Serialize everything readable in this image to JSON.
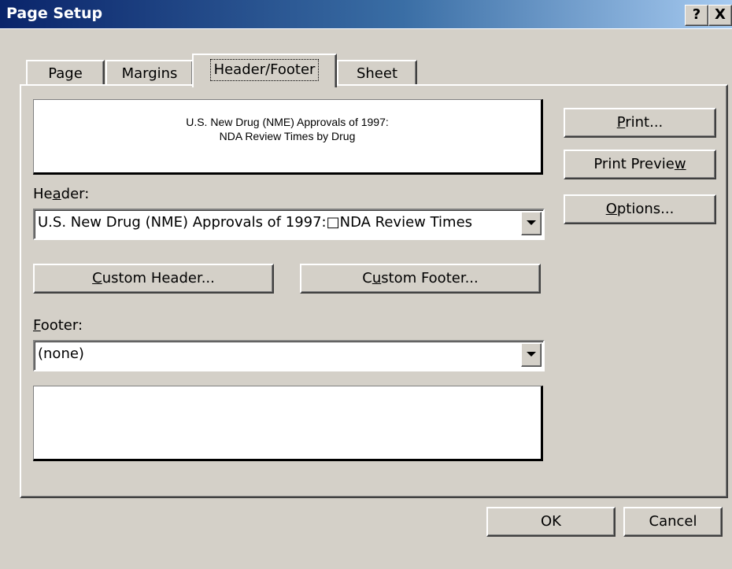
{
  "window": {
    "title": "Page Setup",
    "help_label": "?",
    "close_label": "X"
  },
  "tabs": [
    {
      "label": "Page"
    },
    {
      "label": "Margins"
    },
    {
      "label": "Header/Footer",
      "selected": true
    },
    {
      "label": "Sheet"
    }
  ],
  "header_preview": {
    "line1": "U.S. New Drug (NME) Approvals of 1997:",
    "line2": "NDA Review Times by Drug"
  },
  "header_field": {
    "label_pre": "He",
    "label_acc": "a",
    "label_post": "der:",
    "value": "U.S. New Drug (NME) Approvals of 1997:□NDA Review Times"
  },
  "custom_header": {
    "acc": "C",
    "rest": "ustom Header..."
  },
  "custom_footer": {
    "pre": "C",
    "acc": "u",
    "rest": "stom Footer..."
  },
  "footer_field": {
    "label_acc": "F",
    "label_post": "ooter:",
    "value": "(none)"
  },
  "side_buttons": {
    "print_acc": "P",
    "print_rest": "rint...",
    "preview_pre": "Print Previe",
    "preview_acc": "w",
    "options_acc": "O",
    "options_rest": "ptions..."
  },
  "bottom_buttons": {
    "ok": "OK",
    "cancel": "Cancel"
  },
  "colors": {
    "title_start": "#0a246a",
    "title_end": "#a6caf0",
    "face": "#d4d0c8"
  }
}
